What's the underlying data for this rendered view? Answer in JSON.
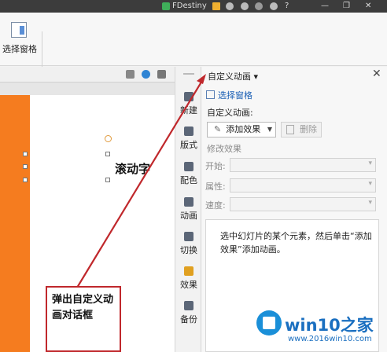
{
  "titlebar": {
    "user": "FDestiny",
    "help_label": "?"
  },
  "ribbon": {
    "selection_pane_label": "选择窗格"
  },
  "slide": {
    "text": "滚动字",
    "accent_color": "#f57c1f"
  },
  "sidebar": {
    "items": [
      {
        "label": "新建",
        "icon": "new-slide-icon"
      },
      {
        "label": "版式",
        "icon": "layout-icon"
      },
      {
        "label": "配色",
        "icon": "palette-icon"
      },
      {
        "label": "动画",
        "icon": "animation-icon"
      },
      {
        "label": "切换",
        "icon": "transition-icon"
      },
      {
        "label": "效果",
        "icon": "effects-icon"
      },
      {
        "label": "备份",
        "icon": "backup-icon"
      }
    ]
  },
  "pane": {
    "title": "自定义动画 ▾",
    "close": "✕",
    "selection_link": "选择窗格",
    "custom_anim_label": "自定义动画:",
    "add_effect": "添加效果",
    "delete": "删除",
    "modify_title": "修改效果",
    "start_label": "开始:",
    "property_label": "属性:",
    "speed_label": "速度:",
    "hint": "选中幻灯片的某个元素，然后单击“添加效果”添加动画。"
  },
  "annotation": {
    "callout_text": "弹出自定义动画对话框",
    "color": "#c0282c"
  },
  "watermark": {
    "brand": "win10之家",
    "url": "www.2016win10.com"
  }
}
